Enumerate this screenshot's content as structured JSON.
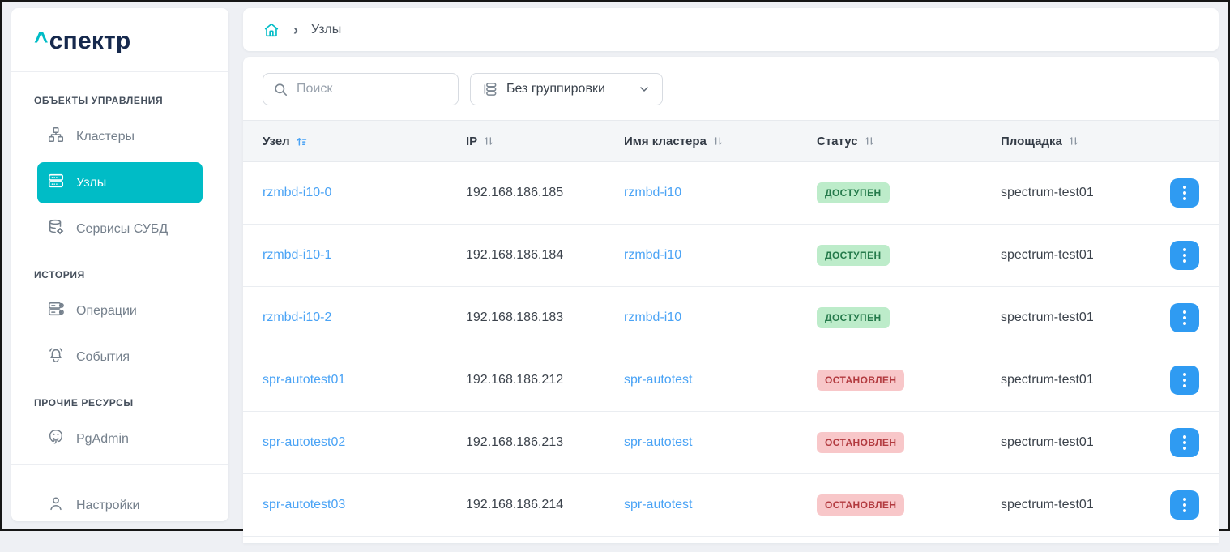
{
  "app": {
    "logo_caret": "^",
    "logo_text": "спектр"
  },
  "colors": {
    "accent_teal": "#00bcc6",
    "link_blue": "#4aa3f5",
    "action_blue": "#2f9bf2",
    "badge_available_bg": "#bdecca",
    "badge_available_text": "#257a4b",
    "badge_stopped_bg": "#f8c7c9",
    "badge_stopped_text": "#b23a3f",
    "page_bg": "#eef0f4"
  },
  "sidebar": {
    "sections": [
      {
        "label": "ОБЪЕКТЫ УПРАВЛЕНИЯ",
        "items": [
          {
            "label": "Кластеры",
            "icon": "clusters-icon",
            "active": false
          },
          {
            "label": "Узлы",
            "icon": "nodes-icon",
            "active": true
          },
          {
            "label": "Сервисы СУБД",
            "icon": "dbms-services-icon",
            "active": false
          }
        ]
      },
      {
        "label": "ИСТОРИЯ",
        "items": [
          {
            "label": "Операции",
            "icon": "operations-icon",
            "active": false
          },
          {
            "label": "События",
            "icon": "events-bell-icon",
            "active": false
          }
        ]
      },
      {
        "label": "ПРОЧИЕ РЕСУРСЫ",
        "items": [
          {
            "label": "PgAdmin",
            "icon": "pgadmin-elephant-icon",
            "active": false
          }
        ]
      }
    ],
    "footer_item": {
      "label": "Настройки",
      "icon": "user-icon"
    }
  },
  "breadcrumb": {
    "home": "home-icon",
    "separator": "›",
    "current": "Узлы"
  },
  "toolbar": {
    "search_placeholder": "Поиск",
    "grouping_label": "Без группировки"
  },
  "table": {
    "columns": [
      {
        "label": "Узел",
        "sort": "asc-active"
      },
      {
        "label": "IP",
        "sort": "inactive"
      },
      {
        "label": "Имя кластера",
        "sort": "inactive"
      },
      {
        "label": "Статус",
        "sort": "inactive"
      },
      {
        "label": "Площадка",
        "sort": "inactive"
      }
    ],
    "rows": [
      {
        "node": "rzmbd-i10-0",
        "ip": "192.168.186.185",
        "cluster": "rzmbd-i10",
        "status": "ДОСТУПЕН",
        "status_type": "available",
        "site": "spectrum-test01"
      },
      {
        "node": "rzmbd-i10-1",
        "ip": "192.168.186.184",
        "cluster": "rzmbd-i10",
        "status": "ДОСТУПЕН",
        "status_type": "available",
        "site": "spectrum-test01"
      },
      {
        "node": "rzmbd-i10-2",
        "ip": "192.168.186.183",
        "cluster": "rzmbd-i10",
        "status": "ДОСТУПЕН",
        "status_type": "available",
        "site": "spectrum-test01"
      },
      {
        "node": "spr-autotest01",
        "ip": "192.168.186.212",
        "cluster": "spr-autotest",
        "status": "ОСТАНОВЛЕН",
        "status_type": "stopped",
        "site": "spectrum-test01"
      },
      {
        "node": "spr-autotest02",
        "ip": "192.168.186.213",
        "cluster": "spr-autotest",
        "status": "ОСТАНОВЛЕН",
        "status_type": "stopped",
        "site": "spectrum-test01"
      },
      {
        "node": "spr-autotest03",
        "ip": "192.168.186.214",
        "cluster": "spr-autotest",
        "status": "ОСТАНОВЛЕН",
        "status_type": "stopped",
        "site": "spectrum-test01"
      }
    ]
  }
}
